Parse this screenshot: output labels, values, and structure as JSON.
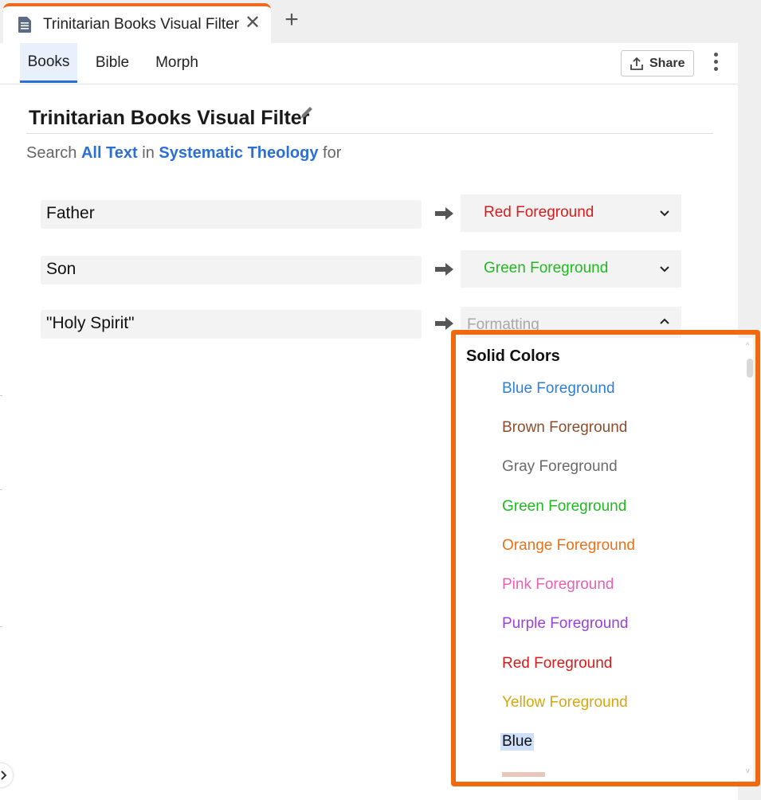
{
  "document_tab": {
    "title": "Trinitarian Books Visual Filter",
    "close_glyph": "✕",
    "new_tab_glyph": "+"
  },
  "panel_tabs": [
    {
      "label": "Books",
      "active": true
    },
    {
      "label": "Bible",
      "active": false
    },
    {
      "label": "Morph",
      "active": false
    }
  ],
  "toolbar": {
    "share_label": "Share"
  },
  "filter": {
    "title": "Trinitarian Books Visual Filter",
    "search_prefix": "Search ",
    "search_scope": "All Text",
    "search_in": " in ",
    "search_resource": "Systematic Theology",
    "search_suffix": " for"
  },
  "rules": [
    {
      "term": "Father",
      "format": "Red Foreground",
      "format_color": "#d81b1b",
      "open": false
    },
    {
      "term": "Son",
      "format": "Green Foreground",
      "format_color": "#1fba1f",
      "open": false
    },
    {
      "term": "\"Holy Spirit\"",
      "format": "Formatting",
      "format_color": "#a8a8a8",
      "open": true
    }
  ],
  "dropdown": {
    "heading": "Solid Colors",
    "options": [
      {
        "label": "Blue Foreground",
        "color": "#2f7fd8"
      },
      {
        "label": "Brown Foreground",
        "color": "#8c4d2c"
      },
      {
        "label": "Gray Foreground",
        "color": "#6b6b6b"
      },
      {
        "label": "Green Foreground",
        "color": "#1fba1f"
      },
      {
        "label": "Orange Foreground",
        "color": "#e8721c"
      },
      {
        "label": "Pink Foreground",
        "color": "#e95fb4"
      },
      {
        "label": "Purple Foreground",
        "color": "#9b42d9"
      },
      {
        "label": "Red Foreground",
        "color": "#d81b1b"
      },
      {
        "label": "Yellow Foreground",
        "color": "#d9a60d"
      },
      {
        "label": "Blue",
        "color": "#111111",
        "selected": true
      }
    ]
  },
  "colors": {
    "accent": "#2b6fd6",
    "highlight_frame": "#f0690f",
    "tab_accent": "#f16a1b"
  }
}
